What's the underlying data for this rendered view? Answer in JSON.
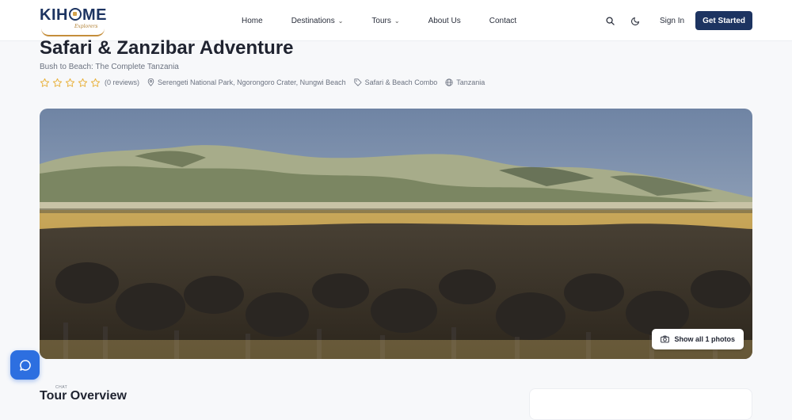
{
  "header": {
    "logo_text": "KIHOME",
    "logo_sub": "Explorers",
    "nav": [
      {
        "label": "Home",
        "dropdown": false
      },
      {
        "label": "Destinations",
        "dropdown": true
      },
      {
        "label": "Tours",
        "dropdown": true
      },
      {
        "label": "About Us",
        "dropdown": false
      },
      {
        "label": "Contact",
        "dropdown": false
      }
    ],
    "search_icon": "search-icon",
    "theme_icon": "moon-icon",
    "signin_label": "Sign In",
    "cta_label": "Get Started"
  },
  "tour": {
    "title": "Safari & Zanzibar Adventure",
    "subtitle": "Bush to Beach: The Complete Tanzania",
    "rating_stars": 0,
    "reviews": "(0 reviews)",
    "locations": "Serengeti National Park, Ngorongoro Crater, Nungwi Beach",
    "category": "Safari & Beach Combo",
    "country": "Tanzania"
  },
  "gallery": {
    "show_all_label": "Show all 1 photos"
  },
  "chat": {
    "label": "CHAT"
  },
  "overview": {
    "title": "Tour Overview"
  },
  "colors": {
    "brand": "#1d3461",
    "star": "#e9b341",
    "chat": "#2d6fe0"
  }
}
